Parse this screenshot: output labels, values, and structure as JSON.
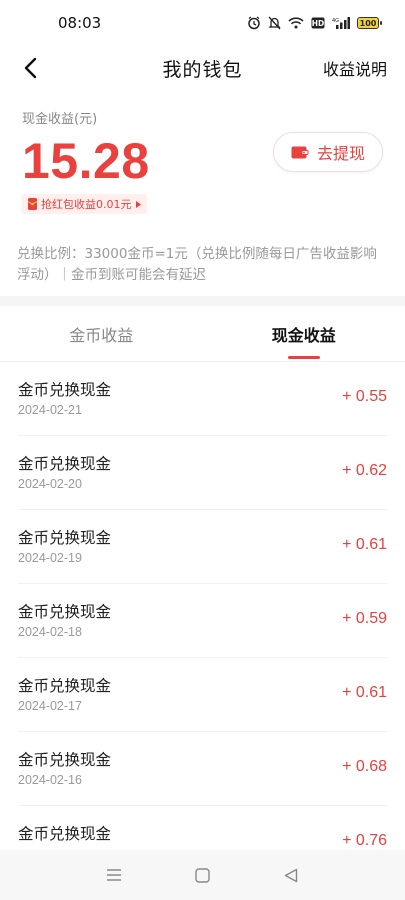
{
  "status_bar": {
    "time": "08:03",
    "battery": "100",
    "icons": [
      "alarm-icon",
      "mute-icon",
      "wifi-icon",
      "hd-icon",
      "signal-icon",
      "battery-icon"
    ]
  },
  "nav": {
    "title": "我的钱包",
    "action": "收益说明",
    "back_icon": "chevron-left-icon"
  },
  "wallet": {
    "cash_label": "现金收益(元)",
    "cash_amount": "15.28",
    "withdraw_label": "去提现",
    "redpacket_label": "抢红包收益0.01元",
    "accent_color": "#e8413e"
  },
  "note": "兑换比例：33000金币=1元（兑换比例随每日广告收益影响浮动）｜金币到账可能会有延迟",
  "tabs": [
    {
      "label": "金币收益",
      "active": false
    },
    {
      "label": "现金收益",
      "active": true
    }
  ],
  "records": [
    {
      "title": "金币兑换现金",
      "date": "2024-02-21",
      "amount": "+ 0.55"
    },
    {
      "title": "金币兑换现金",
      "date": "2024-02-20",
      "amount": "+ 0.62"
    },
    {
      "title": "金币兑换现金",
      "date": "2024-02-19",
      "amount": "+ 0.61"
    },
    {
      "title": "金币兑换现金",
      "date": "2024-02-18",
      "amount": "+ 0.59"
    },
    {
      "title": "金币兑换现金",
      "date": "2024-02-17",
      "amount": "+ 0.61"
    },
    {
      "title": "金币兑换现金",
      "date": "2024-02-16",
      "amount": "+ 0.68"
    },
    {
      "title": "金币兑换现金",
      "date": "",
      "amount": "+ 0.76"
    }
  ],
  "system_nav": [
    "menu-icon",
    "home-icon",
    "back-icon"
  ]
}
